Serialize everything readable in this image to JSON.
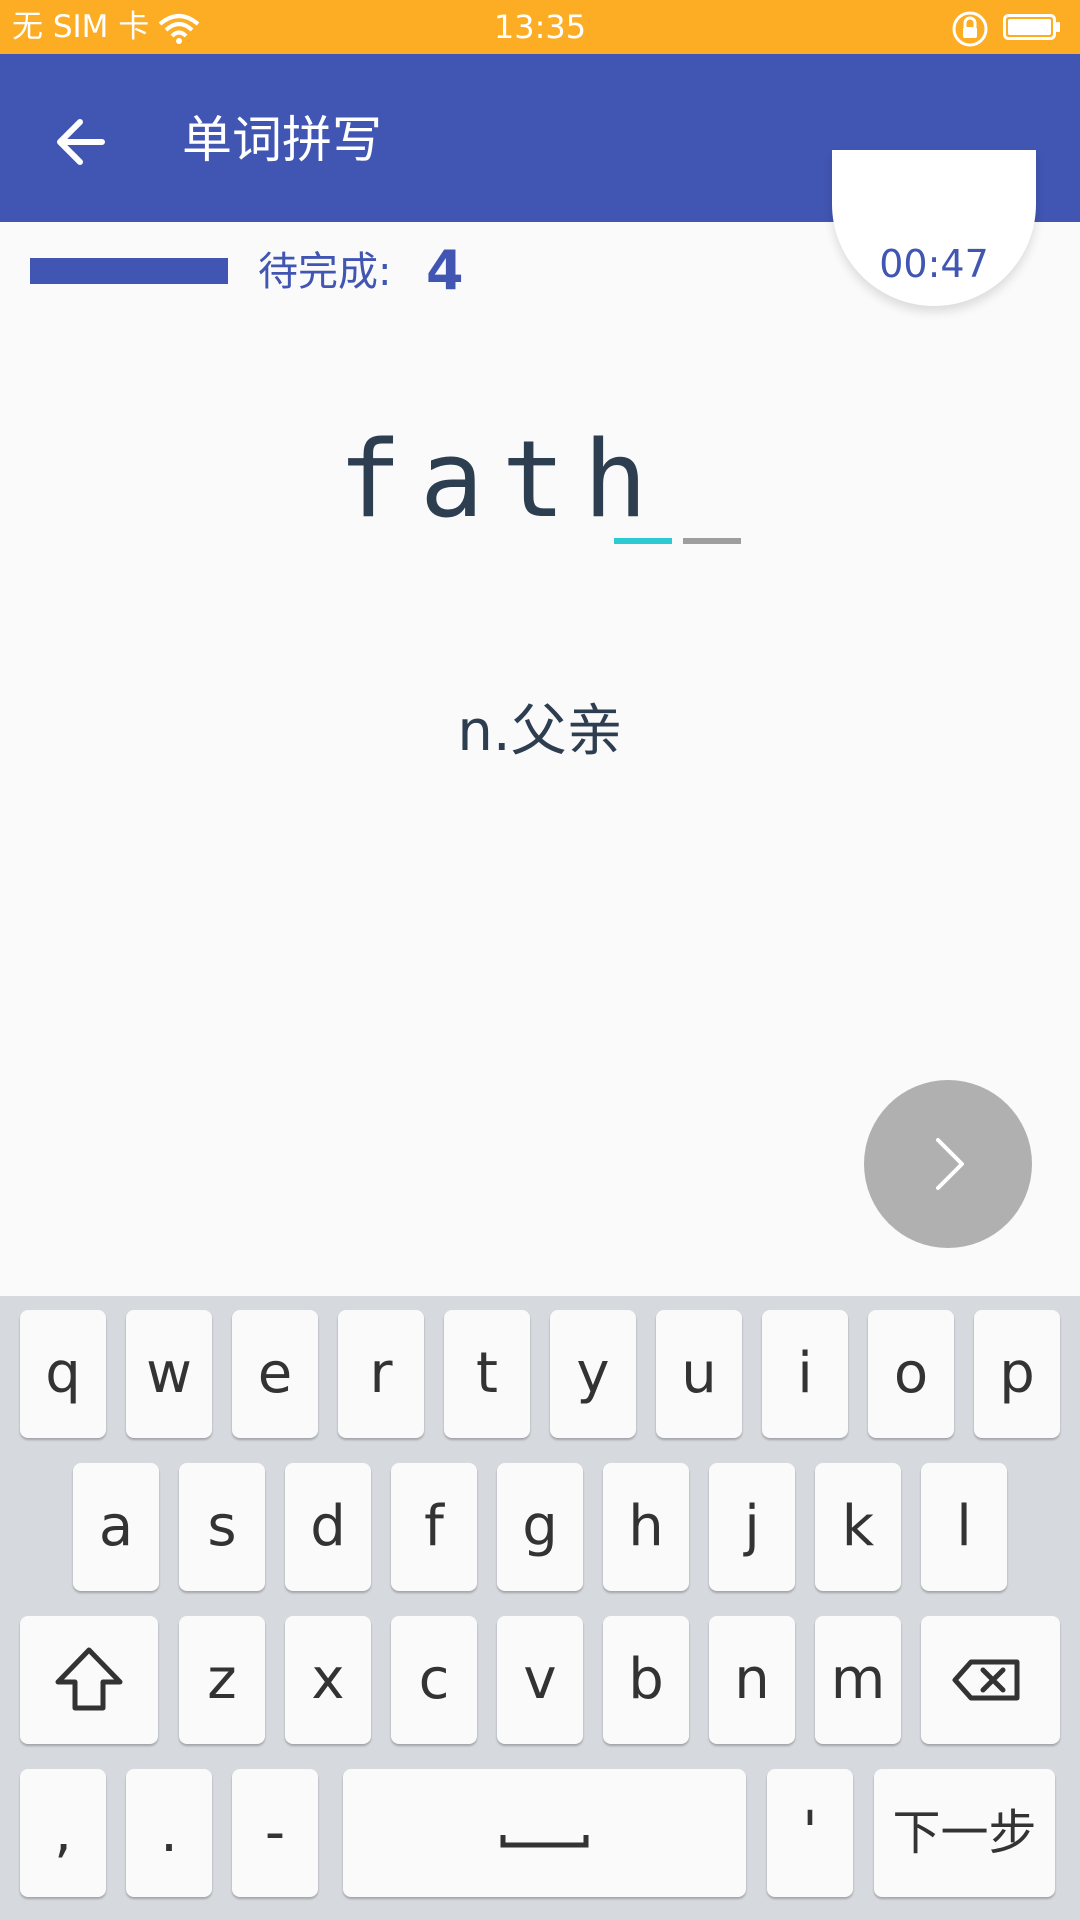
{
  "status_bar": {
    "carrier": "无 SIM 卡",
    "time": "13:35",
    "icons": [
      "wifi-icon",
      "lock-rotate-icon",
      "battery-icon"
    ]
  },
  "app_bar": {
    "back_icon": "arrow-left-icon",
    "title": "单词拼写"
  },
  "progress": {
    "label": "待完成:",
    "remaining": "4",
    "bar_fill_fraction": 1.0
  },
  "timer": "00:47",
  "word": {
    "visible_letters": "fath",
    "blanks": 2,
    "active_blank_color": "#2ecad4",
    "blank_color": "#9e9e9e"
  },
  "meaning": "n.父亲",
  "next_icon": "chevron-right-icon",
  "keyboard": {
    "row1": [
      "q",
      "w",
      "e",
      "r",
      "t",
      "y",
      "u",
      "i",
      "o",
      "p"
    ],
    "row2": [
      "a",
      "s",
      "d",
      "f",
      "g",
      "h",
      "j",
      "k",
      "l"
    ],
    "row3": [
      "z",
      "x",
      "c",
      "v",
      "b",
      "n",
      "m"
    ],
    "row4": {
      "comma": ",",
      "period": ".",
      "dash": "-",
      "apostrophe": "'",
      "next_step": "下一步"
    },
    "icons": [
      "shift-icon",
      "backspace-icon",
      "space-icon"
    ]
  },
  "colors": {
    "status_bar": "#FDAD24",
    "primary": "#4156B2",
    "text_dark": "#2c3e50",
    "next_button": "#b0b0b0"
  }
}
